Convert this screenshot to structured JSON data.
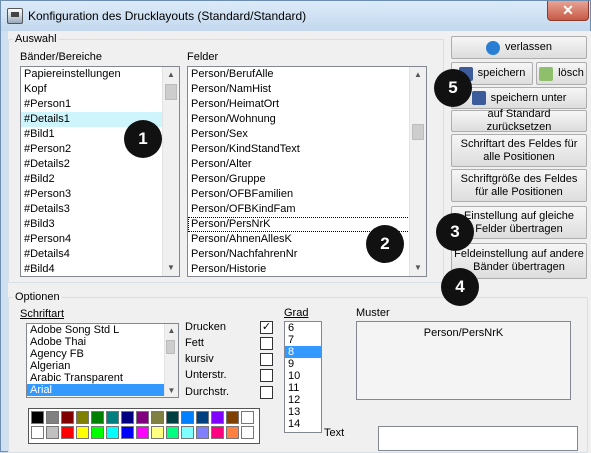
{
  "window": {
    "title": "Konfiguration des Drucklayouts (Standard/Standard)",
    "close_glyph": "✕"
  },
  "auswahl": {
    "legend": "Auswahl",
    "baender_label": "Bänder/Bereiche",
    "felder_label": "Felder",
    "baender": [
      "Papiereinstellungen",
      "Kopf",
      "#Person1",
      "#Details1",
      "#Bild1",
      "#Person2",
      "#Details2",
      "#Bild2",
      "#Person3",
      "#Details3",
      "#Bild3",
      "#Person4",
      "#Details4",
      "#Bild4"
    ],
    "baender_selected": 3,
    "felder": [
      "Person/BerufAlle",
      "Person/NamHist",
      "Person/HeimatOrt",
      "Person/Wohnung",
      "Person/Sex",
      "Person/KindStandText",
      "Person/Alter",
      "Person/Gruppe",
      "Person/OFBFamilien",
      "Person/OFBKindFam",
      "Person/PersNrK",
      "Person/AhnenAllesK",
      "Person/NachfahrenNr",
      "Person/Historie"
    ],
    "felder_selected": 10
  },
  "buttons": {
    "verlassen": "verlassen",
    "speichern": "speichern",
    "loesch": "lösch",
    "speichern_unter": "speichern unter",
    "standard": "auf Standard zurücksetzen",
    "schriftart_alle": "Schriftart des Feldes für alle Positionen",
    "schriftgroesse_alle": "Schriftgröße des Feldes für alle Positionen",
    "einstellung_gleiche": "Einstellung auf gleiche Felder übertragen",
    "einstellung_andere": "Feldeinstellung auf andere Bänder übertragen"
  },
  "optionen": {
    "legend": "Optionen",
    "schriftart_label": "Schriftart",
    "fonts": [
      "Adobe Song Std L",
      "Adobe Thai",
      "Agency FB",
      "Algerian",
      "Arabic Transparent",
      "Arial"
    ],
    "font_selected": 5,
    "drucken_label": "Drucken",
    "fett_label": "Fett",
    "kursiv_label": "kursiv",
    "unterstr_label": "Unterstr.",
    "durchstr_label": "Durchstr.",
    "drucken_checked": "✓",
    "grad_label": "Grad",
    "grad_values": [
      "6",
      "7",
      "8",
      "9",
      "10",
      "11",
      "12",
      "13",
      "14"
    ],
    "grad_selected": 2,
    "muster_label": "Muster",
    "muster_preview": "Person/PersNrK",
    "text_label": "Text"
  },
  "palette": [
    "#000000",
    "#808080",
    "#800000",
    "#808000",
    "#008000",
    "#008080",
    "#000080",
    "#800080",
    "#808040",
    "#004040",
    "#0080ff",
    "#004080",
    "#8000ff",
    "#804000",
    "#ffffff",
    "#ffffff",
    "#c0c0c0",
    "#ff0000",
    "#ffff00",
    "#00ff00",
    "#00ffff",
    "#0000ff",
    "#ff00ff",
    "#ffff80",
    "#00ff80",
    "#80ffff",
    "#8080ff",
    "#ff0080",
    "#ff8040",
    "#ffffff"
  ],
  "badges": [
    "1",
    "2",
    "3",
    "4",
    "5"
  ],
  "colors": {
    "selection_blue": "#3399ff",
    "selection_cyan": "#cdf5fb",
    "titlebar": "#c9dcef"
  }
}
